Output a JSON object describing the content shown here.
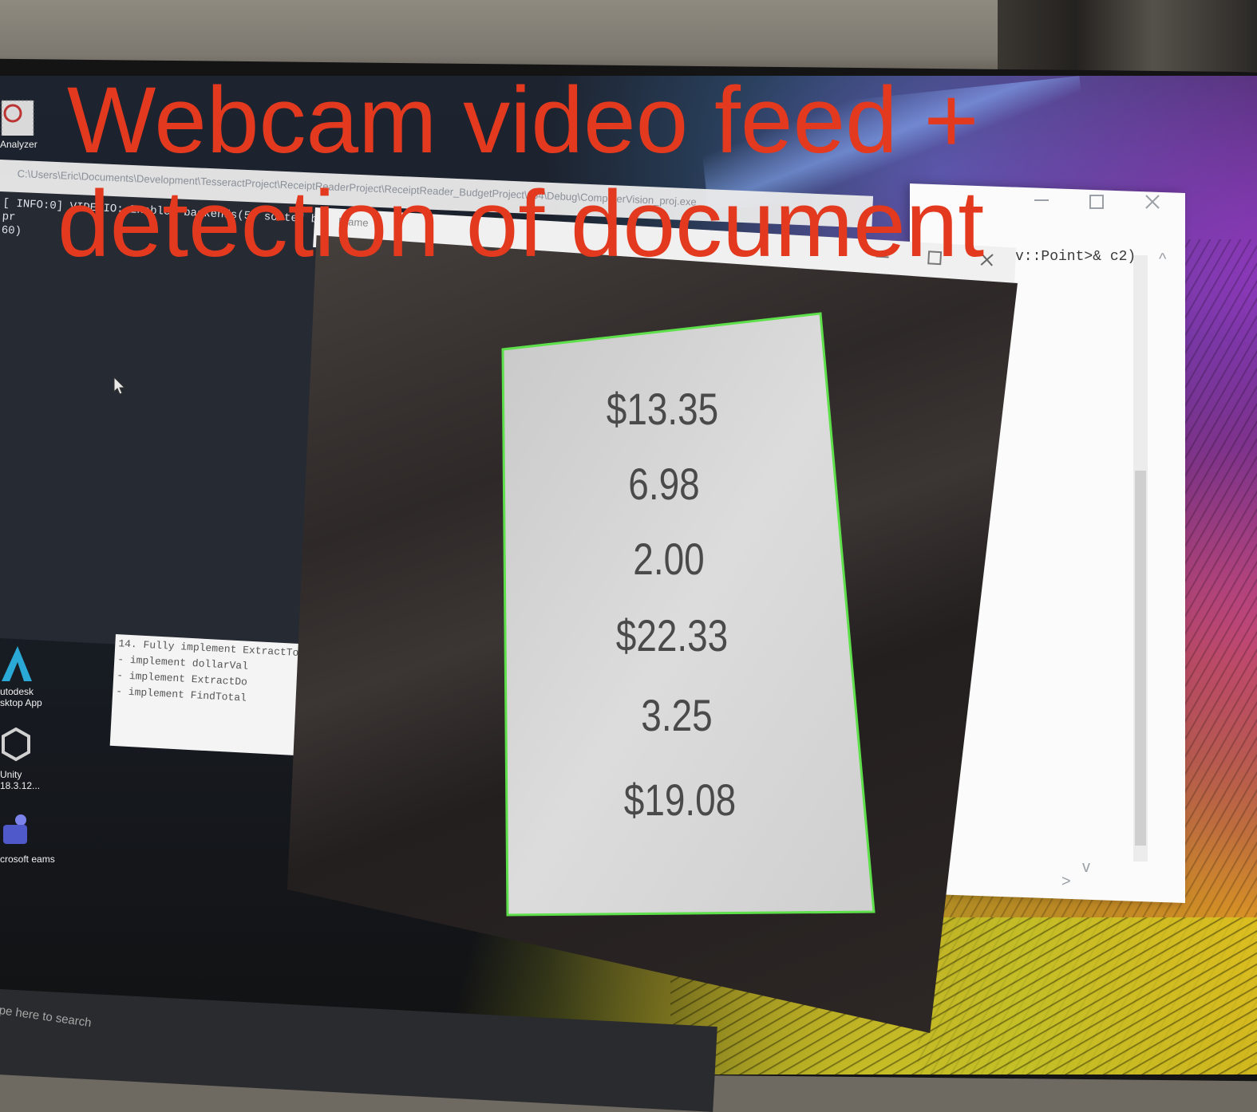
{
  "caption": {
    "line1": "Webcam video feed +",
    "line2": "detection of document"
  },
  "console": {
    "title_path": "C:\\Users\\Eric\\Documents\\Development\\TesseractProject\\ReceiptReaderProject\\ReceiptReader_BudgetProject\\x64\\Debug\\ComputerVision_proj.exe",
    "line1": "[ INFO:0] VIDEOIO: Enabled backends(5, sorted by pr",
    "line2": "60)"
  },
  "cam_window": {
    "title": "Frame"
  },
  "editor": {
    "code_fragment": "v::Point>& c2)",
    "scroll_up": "^",
    "scroll_down": "v",
    "scroll_right": ">"
  },
  "todo": {
    "lines": [
      "14. Fully implement ExtractTo",
      "    - implement dollarVal",
      "    - implement ExtractDo",
      "    - implement FindTotal"
    ]
  },
  "desktop_icons": [
    {
      "label": "Analyzer",
      "icon": "analyzer-icon"
    },
    {
      "label": "utodesk sktop App",
      "icon": "autodesk-icon"
    },
    {
      "label": "Unity 18.3.12...",
      "icon": "unity-icon"
    },
    {
      "label": "crosoft eams",
      "icon": "teams-icon"
    }
  ],
  "taskbar": {
    "search_placeholder": "pe here to search"
  },
  "receipt": {
    "amounts": [
      "$13.35",
      "6.98",
      "2.00",
      "$22.33",
      "3.25",
      "$19.08"
    ],
    "detection_color": "#5ee04a"
  },
  "colors": {
    "caption": "#e3391f"
  }
}
